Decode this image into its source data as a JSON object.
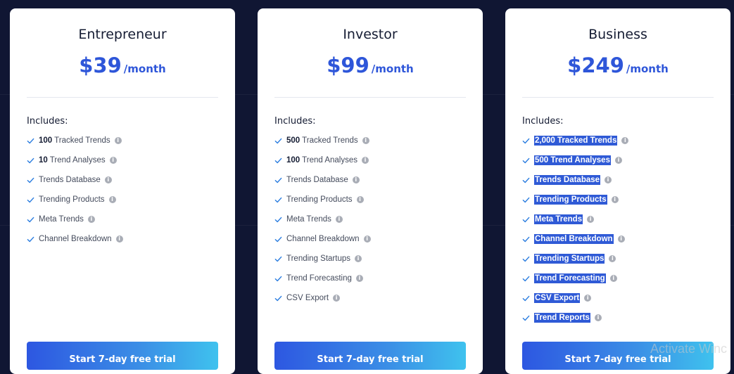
{
  "plans": [
    {
      "name": "Entrepreneur",
      "price": "$39",
      "period": "/month",
      "includes_label": "Includes:",
      "features": [
        {
          "bold": "100",
          "text": " Tracked Trends",
          "highlight": false
        },
        {
          "bold": "10",
          "text": " Trend Analyses",
          "highlight": false
        },
        {
          "bold": "",
          "text": "Trends Database",
          "highlight": false
        },
        {
          "bold": "",
          "text": "Trending Products",
          "highlight": false
        },
        {
          "bold": "",
          "text": "Meta Trends",
          "highlight": false
        },
        {
          "bold": "",
          "text": "Channel Breakdown",
          "highlight": false
        }
      ],
      "cta_label": "Start 7-day free trial"
    },
    {
      "name": "Investor",
      "price": "$99",
      "period": "/month",
      "includes_label": "Includes:",
      "features": [
        {
          "bold": "500",
          "text": " Tracked Trends",
          "highlight": false
        },
        {
          "bold": "100",
          "text": " Trend Analyses",
          "highlight": false
        },
        {
          "bold": "",
          "text": "Trends Database",
          "highlight": false
        },
        {
          "bold": "",
          "text": "Trending Products",
          "highlight": false
        },
        {
          "bold": "",
          "text": "Meta Trends",
          "highlight": false
        },
        {
          "bold": "",
          "text": "Channel Breakdown",
          "highlight": false
        },
        {
          "bold": "",
          "text": "Trending Startups",
          "highlight": false
        },
        {
          "bold": "",
          "text": "Trend Forecasting",
          "highlight": false
        },
        {
          "bold": "",
          "text": "CSV Export",
          "highlight": false
        }
      ],
      "cta_label": "Start 7-day free trial"
    },
    {
      "name": "Business",
      "price": "$249",
      "period": "/month",
      "includes_label": "Includes:",
      "features": [
        {
          "bold": "2,000",
          "text": " Tracked Trends",
          "highlight": true
        },
        {
          "bold": "500",
          "text": " Trend Analyses",
          "highlight": true
        },
        {
          "bold": "",
          "text": "Trends Database",
          "highlight": true
        },
        {
          "bold": "",
          "text": "Trending Products",
          "highlight": true
        },
        {
          "bold": "",
          "text": "Meta Trends",
          "highlight": true
        },
        {
          "bold": "",
          "text": "Channel Breakdown",
          "highlight": true
        },
        {
          "bold": "",
          "text": "Trending Startups",
          "highlight": true
        },
        {
          "bold": "",
          "text": "Trend Forecasting",
          "highlight": true
        },
        {
          "bold": "",
          "text": "CSV Export",
          "highlight": true
        },
        {
          "bold": "",
          "text": "Trend Reports",
          "highlight": true
        }
      ],
      "cta_label": "Start 7-day free trial"
    }
  ],
  "icons": {
    "check": "check-icon",
    "info": "info-icon"
  },
  "info_glyph": "i",
  "colors": {
    "accent": "#2e56d9",
    "selection": "#2f5ad6",
    "background": "#101633"
  },
  "watermark": "Activate Winc"
}
